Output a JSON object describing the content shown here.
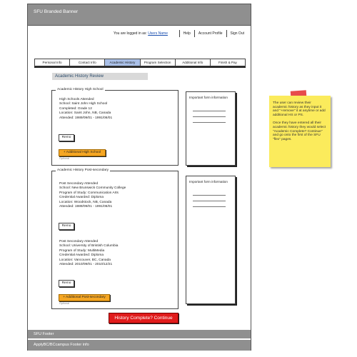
{
  "banner": {
    "title": "SFU Branded Banner"
  },
  "header": {
    "logged_prefix": "You are logged in as:",
    "username": "Users Name",
    "links": [
      "Help",
      "Account Profile",
      "Sign Out"
    ]
  },
  "tabs": [
    {
      "label": "Personal Info",
      "active": false
    },
    {
      "label": "Contact Info",
      "active": false
    },
    {
      "label": "Academic History",
      "active": true
    },
    {
      "label": "Program Selection",
      "active": false
    },
    {
      "label": "Additional Info",
      "active": false
    },
    {
      "label": "Finish & Pay",
      "active": false
    }
  ],
  "page_title": "Academic History Review",
  "high_school": {
    "legend": "Academic History High School",
    "lines": [
      "High Schools Attended",
      "School: Saint John High School",
      "Completed: Grade 12",
      "Location: Saint John, NB, Canada",
      "Attended: 1989/09/01 - 1991/06/01"
    ],
    "remove_label": "Remo",
    "add_label": "+ Additional High School",
    "optional_label": "Optional",
    "info_text": "Important form information"
  },
  "post_secondary": {
    "legend": "Academic History Post-secondary",
    "entries": [
      {
        "lines": [
          "Post Secondary Attended",
          "School: New Brunswick Community College",
          "Program of Study: Communication Arts",
          "Credential Awarded: Diploma",
          "Location: Woodstock, NB, Canada",
          "Attended: 1989/09/01 - 1991/06/01"
        ],
        "remove_label": "Remo"
      },
      {
        "lines": [
          "Post Secondary Attended",
          "School: University of Bristish Columbia",
          "Program of Study: MultiMedia",
          "Credential Awarded: Diploma",
          "Location: Vancouver, BC, Canada",
          "Attended: 2010/09/01 - 2010/12/21"
        ],
        "remove_label": "Remo"
      }
    ],
    "add_label": "+ Additional Post-secondary",
    "optional_label": "Optional",
    "info_text": "Important form information"
  },
  "continue_label": "History Complete? Continue",
  "footer": {
    "title": "SFU Footer",
    "subtitle": "ApplyBC/BCcampus Footer info"
  },
  "note": {
    "paragraph1": "The user can review their academic history as they input it and \"+remove\" it at anytime or add additional HS or PS.",
    "paragraph2": "Once they have entered all their academic history they would select \"Academic Complete? Continue\" and go onto the first of the SFU \"flex\" pages."
  },
  "colors": {
    "banner": "#8f8f8f",
    "active_tab": "#aac0e8",
    "add_button": "#f5a623",
    "continue_button": "#e01b1b",
    "sticky_note": "#fbeb5c"
  }
}
